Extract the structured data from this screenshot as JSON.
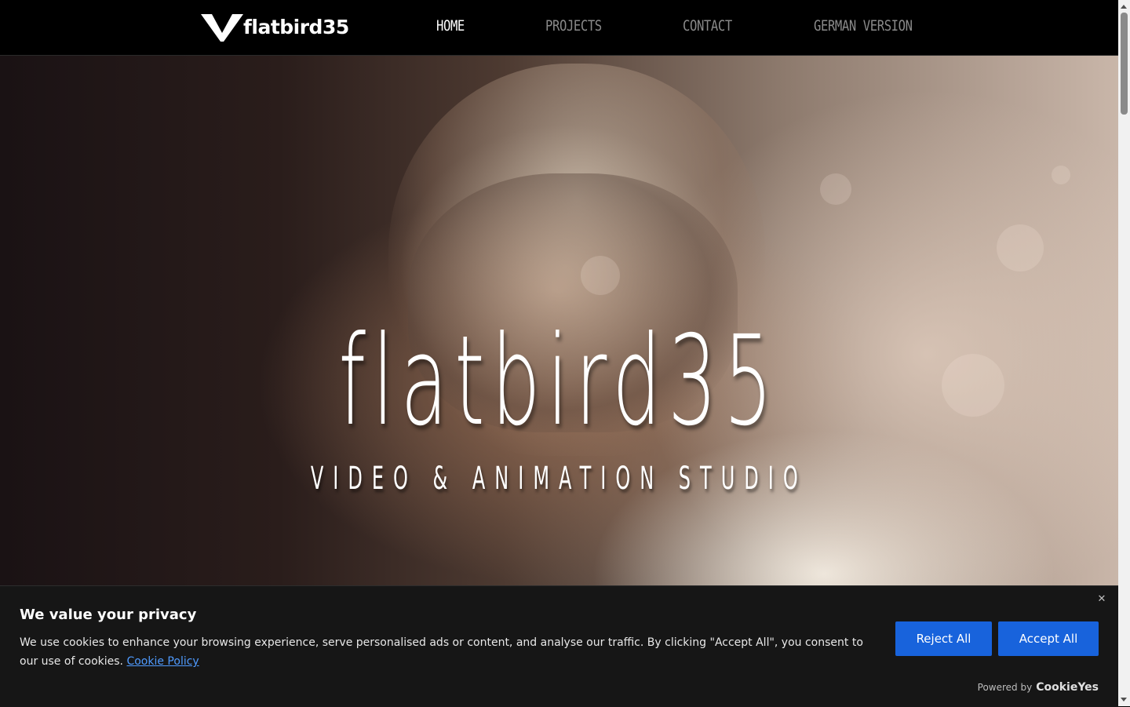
{
  "header": {
    "logo_text": "flatbird35",
    "nav": [
      {
        "label": "HOME",
        "active": true
      },
      {
        "label": "PROJECTS",
        "active": false
      },
      {
        "label": "CONTACT",
        "active": false
      },
      {
        "label": "GERMAN VERSION",
        "active": false
      }
    ]
  },
  "hero": {
    "title": "flatbird35",
    "subtitle": "VIDEO & ANIMATION STUDIO"
  },
  "cookie_banner": {
    "title": "We value your privacy",
    "text": "We use cookies to enhance your browsing experience, serve personalised ads or content, and analyse our traffic. By clicking \"Accept All\", you consent to our use of cookies.",
    "policy_link": "Cookie Policy",
    "close_symbol": "✕",
    "reject_label": "Reject All",
    "accept_label": "Accept All",
    "powered_by_label": "Powered by",
    "powered_by_brand": "CookieYes",
    "button_color": "#1863dc",
    "link_color": "#4f9bff"
  }
}
